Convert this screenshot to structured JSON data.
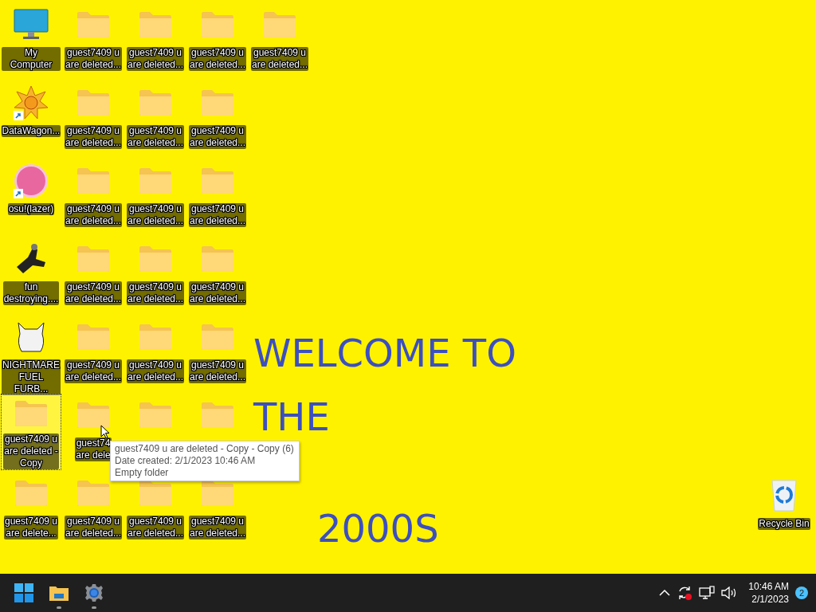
{
  "desktop_icons": [
    {
      "kind": "computer",
      "label": "My Computer",
      "selected": false
    },
    {
      "kind": "star-app",
      "label": "DataWagon...",
      "selected": false,
      "shortcut": true
    },
    {
      "kind": "osu",
      "label": "osu!(lazer)",
      "selected": false,
      "shortcut": true
    },
    {
      "kind": "figure",
      "label": "fun\ndestroying....",
      "selected": false
    },
    {
      "kind": "furby",
      "label": "NIGHTMARE\nFUEL FURB...",
      "selected": false
    },
    {
      "kind": "folder",
      "label": "guest7409 u\nare deleted -\nCopy",
      "selected": true
    },
    {
      "kind": "folder",
      "label": "guest7409 u\nare delete...",
      "selected": false
    },
    {
      "kind": "folder",
      "label": "guest7409 u\nare deleted...",
      "selected": false
    },
    {
      "kind": "folder",
      "label": "guest7409 u\nare deleted...",
      "selected": false
    },
    {
      "kind": "folder",
      "label": "guest7409 u\nare deleted...",
      "selected": false
    },
    {
      "kind": "folder",
      "label": "guest7409 u\nare deleted...",
      "selected": false
    },
    {
      "kind": "folder",
      "label": "guest7409 u\nare deleted...",
      "selected": false
    },
    {
      "kind": "folder",
      "label": "guest74\nare dele",
      "selected": false
    },
    {
      "kind": "folder",
      "label": "guest7409 u\nare deleted...",
      "selected": false
    },
    {
      "kind": "folder",
      "label": "guest7409 u\nare deleted...",
      "selected": false
    },
    {
      "kind": "folder",
      "label": "guest7409 u\nare deleted...",
      "selected": false
    },
    {
      "kind": "folder",
      "label": "guest7409 u\nare deleted...",
      "selected": false
    },
    {
      "kind": "folder",
      "label": "guest7409 u\nare deleted...",
      "selected": false
    },
    {
      "kind": "folder",
      "label": "guest7409 u\nare deleted...",
      "selected": false
    },
    {
      "kind": "folder",
      "selected": false
    },
    {
      "kind": "folder",
      "label": "guest7409 u\nare deleted...",
      "selected": false
    },
    {
      "kind": "folder",
      "label": "guest7409 u\nare deleted...",
      "selected": false
    },
    {
      "kind": "folder",
      "label": "guest7409 u\nare deleted...",
      "selected": false
    },
    {
      "kind": "folder",
      "label": "guest7409 u\nare deleted...",
      "selected": false
    },
    {
      "kind": "folder",
      "label": "guest7409 u\nare deleted...",
      "selected": false
    },
    {
      "kind": "folder",
      "label": "guest7409 u\nare deleted...",
      "selected": false
    },
    {
      "kind": "folder",
      "selected": false
    },
    {
      "kind": "folder",
      "label": "guest7409 u\nare deleted...",
      "selected": false
    },
    {
      "kind": "folder",
      "label": "guest7409 u\nare deleted...",
      "selected": false
    }
  ],
  "wallpaper": {
    "lines": [
      "WELCOME TO",
      "THE",
      "2000S"
    ]
  },
  "tooltip": {
    "lines": [
      "guest7409 u are deleted - Copy - Copy (6)",
      "Date created: 2/1/2023 10:46 AM",
      "Empty folder"
    ]
  },
  "recycle_bin": {
    "label": "Recycle Bin"
  },
  "taskbar": {
    "apps": [
      {
        "kind": "start",
        "running": false
      },
      {
        "kind": "explorer",
        "running": true
      },
      {
        "kind": "settings",
        "running": true
      }
    ],
    "tray": {
      "sync_error": true
    },
    "clock": {
      "time": "10:46 AM",
      "date": "2/1/2023"
    },
    "notifications": "2"
  }
}
